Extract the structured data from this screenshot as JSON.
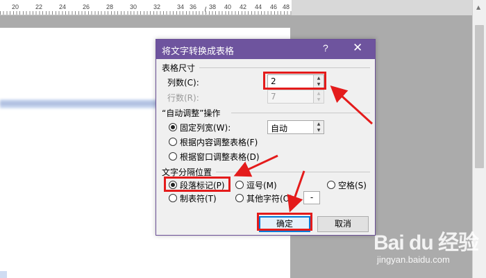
{
  "ruler": {
    "numbers": [
      "20",
      "22",
      "24",
      "26",
      "28",
      "30",
      "32",
      "34",
      "36",
      "38",
      "40",
      "42",
      "44",
      "46",
      "48"
    ],
    "marker": "⟨"
  },
  "dialog": {
    "title": "将文字转换成表格",
    "help": "?",
    "close": "✕",
    "size_group": {
      "label": "表格尺寸",
      "columns_label": "列数(C):",
      "columns_value": "2",
      "rows_label": "行数(R):",
      "rows_value": "7"
    },
    "autofit_group": {
      "label": "“自动调整”操作",
      "options": [
        {
          "label": "固定列宽(W):",
          "selected": true
        },
        {
          "label": "根据内容调整表格(F)",
          "selected": false
        },
        {
          "label": "根据窗口调整表格(D)",
          "selected": false
        }
      ],
      "fixed_width_value": "自动"
    },
    "separator_group": {
      "label": "文字分隔位置",
      "paragraph": "段落标记(P)",
      "comma": "逗号(M)",
      "space": "空格(S)",
      "tab": "制表符(T)",
      "other": "其他字符(O):",
      "other_value": "-",
      "selected": "paragraph"
    },
    "ok_label": "确定",
    "cancel_label": "取消"
  },
  "watermark": {
    "logo": "Bai du 经验",
    "url": "jingyan.baidu.com"
  },
  "colors": {
    "titlebar": "#6e549e",
    "annotation": "#e41b1b"
  }
}
